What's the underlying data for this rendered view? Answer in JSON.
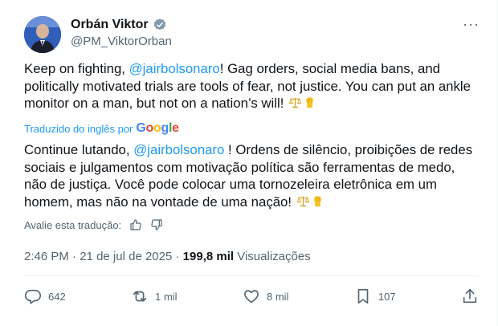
{
  "author": {
    "name": "Orbán Viktor",
    "handle": "@PM_ViktorOrban",
    "verified_color": "#829aab",
    "more_label": "···"
  },
  "original": {
    "p1": "Keep on fighting, ",
    "mention": "@jairbolsonaro",
    "p2": "! Gag orders, social media bans, and politically motivated trials are tools of fear, not justice. You can put an ankle monitor on a man, but not on a nation’s will! "
  },
  "translation": {
    "label": "Traduzido do inglês por",
    "provider": "Google",
    "p1": "Continue lutando, ",
    "mention": "@jairbolsonaro",
    "p2": " ! Ordens de silêncio, proibições de redes sociais e julgamentos com motivação política são ferramentas de medo, não de justiça. Você pode colocar uma tornozeleira eletrônica em um homem, mas não na vontade de uma nação! ",
    "rate_label": "Avalie esta tradução:"
  },
  "meta": {
    "time": "2:46 PM",
    "sep1": " · ",
    "date": "21 de jul de 2025",
    "sep2": " · ",
    "views": "199,8 mil",
    "views_label": " Visualizações"
  },
  "actions": {
    "replies": "642",
    "reposts": "1 mil",
    "likes": "8 mil",
    "bookmarks": "107"
  },
  "icons": [
    "verified-badge-icon",
    "balance-scale-icon",
    "raised-fist-icon",
    "thumbs-up-icon",
    "thumbs-down-icon",
    "reply-icon",
    "repost-icon",
    "like-icon",
    "bookmark-icon",
    "share-icon"
  ],
  "colors": {
    "accent": "#1d9bf0",
    "text": "#0f1419",
    "muted": "#536471"
  }
}
